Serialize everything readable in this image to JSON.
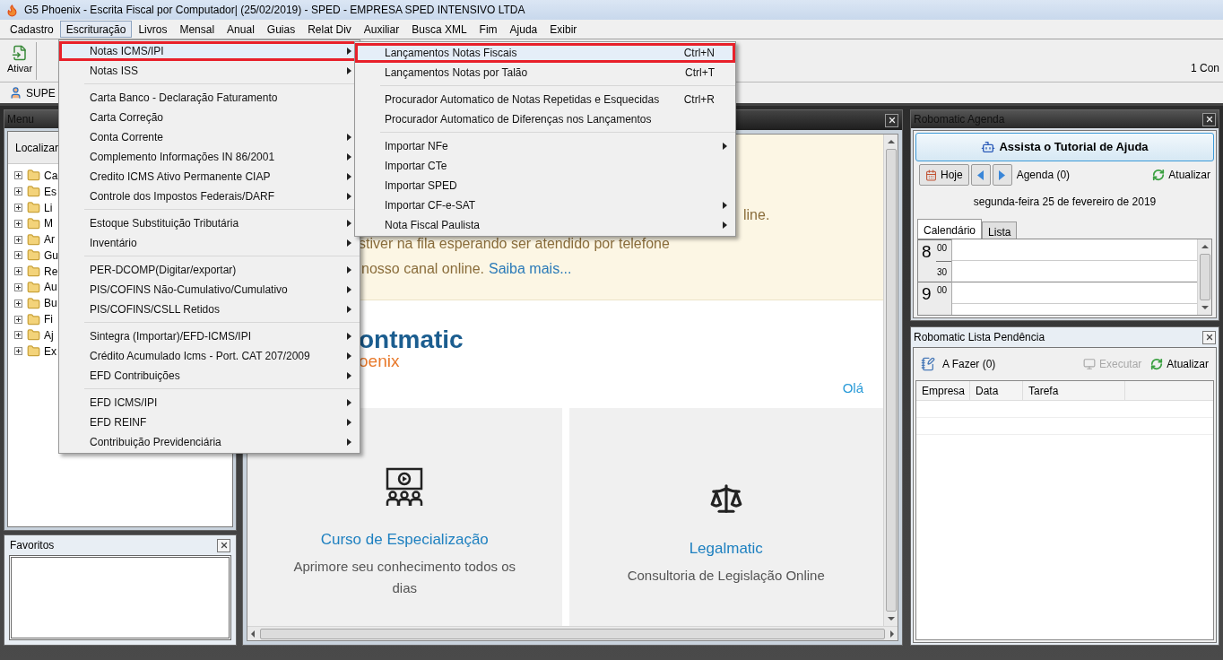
{
  "window": {
    "title": "G5 Phoenix - Escrita Fiscal por Computador| (25/02/2019) - SPED - EMPRESA SPED INTENSIVO LTDA"
  },
  "menu_bar": [
    {
      "label": "Cadastro",
      "selected": false
    },
    {
      "label": "Escrituração",
      "selected": true
    },
    {
      "label": "Livros",
      "selected": false
    },
    {
      "label": "Mensal",
      "selected": false
    },
    {
      "label": "Anual",
      "selected": false
    },
    {
      "label": "Guias",
      "selected": false
    },
    {
      "label": "Relat Div",
      "selected": false
    },
    {
      "label": "Auxiliar",
      "selected": false
    },
    {
      "label": "Busca XML",
      "selected": false
    },
    {
      "label": "Fim",
      "selected": false
    },
    {
      "label": "Ajuda",
      "selected": false
    },
    {
      "label": "Exibir",
      "selected": false
    }
  ],
  "toolbar": {
    "button": "Ativar",
    "status": "1 Con"
  },
  "user": {
    "name": "SUPE"
  },
  "escrituracao_menu": {
    "groups": [
      [
        {
          "label": "Notas ICMS/IPI",
          "has_submenu": true,
          "selected": true
        },
        {
          "label": "Notas ISS",
          "has_submenu": true,
          "selected": false
        }
      ],
      [
        {
          "label": "Carta Banco - Declaração Faturamento",
          "has_submenu": false,
          "selected": false
        },
        {
          "label": "Carta Correção",
          "has_submenu": false,
          "selected": false
        },
        {
          "label": "Conta Corrente",
          "has_submenu": true,
          "selected": false
        },
        {
          "label": "Complemento Informações IN 86/2001",
          "has_submenu": true,
          "selected": false
        },
        {
          "label": "Credito ICMS Ativo Permanente CIAP",
          "has_submenu": true,
          "selected": false
        },
        {
          "label": "Controle dos Impostos Federais/DARF",
          "has_submenu": true,
          "selected": false
        }
      ],
      [
        {
          "label": "Estoque Substituição Tributária",
          "has_submenu": true,
          "selected": false
        },
        {
          "label": "Inventário",
          "has_submenu": true,
          "selected": false
        }
      ],
      [
        {
          "label": "PER-DCOMP(Digitar/exportar)",
          "has_submenu": true,
          "selected": false
        },
        {
          "label": "PIS/COFINS Não-Cumulativo/Cumulativo",
          "has_submenu": true,
          "selected": false
        },
        {
          "label": "PIS/COFINS/CSLL Retidos",
          "has_submenu": true,
          "selected": false
        }
      ],
      [
        {
          "label": "Sintegra (Importar)/EFD-ICMS/IPI",
          "has_submenu": true,
          "selected": false
        },
        {
          "label": "Crédito Acumulado Icms - Port. CAT 207/2009",
          "has_submenu": true,
          "selected": false
        },
        {
          "label": "EFD Contribuições",
          "has_submenu": true,
          "selected": false
        }
      ],
      [
        {
          "label": "EFD ICMS/IPI",
          "has_submenu": true,
          "selected": false
        },
        {
          "label": "EFD REINF",
          "has_submenu": true,
          "selected": false
        },
        {
          "label": "Contribuição Previdenciária",
          "has_submenu": true,
          "selected": false
        }
      ]
    ]
  },
  "submenu": {
    "groups": [
      [
        {
          "label": "Lançamentos Notas Fiscais",
          "shortcut": "Ctrl+N",
          "has_submenu": false,
          "selected": true
        },
        {
          "label": "Lançamentos Notas por Talão",
          "shortcut": "Ctrl+T",
          "has_submenu": false,
          "selected": false
        }
      ],
      [
        {
          "label": "Procurador Automatico de Notas Repetidas e Esquecidas",
          "shortcut": "Ctrl+R",
          "has_submenu": false,
          "selected": false
        },
        {
          "label": "Procurador Automatico de Diferenças nos Lançamentos",
          "has_submenu": false,
          "selected": false
        }
      ],
      [
        {
          "label": "Importar NFe",
          "has_submenu": true,
          "selected": false
        },
        {
          "label": "Importar CTe",
          "has_submenu": false,
          "selected": false
        },
        {
          "label": "Importar SPED",
          "has_submenu": false,
          "selected": false
        },
        {
          "label": "Importar CF-e-SAT",
          "has_submenu": true,
          "selected": false
        },
        {
          "label": "Nota Fiscal Paulista",
          "has_submenu": true,
          "selected": false
        }
      ]
    ]
  },
  "menu_panel": {
    "title": "Menu",
    "search_label": "Localizar",
    "tree": [
      {
        "label": "Ca",
        "expanded": false
      },
      {
        "label": "Es",
        "expanded": false
      },
      {
        "label": "Li",
        "expanded": false
      },
      {
        "label": "M",
        "expanded": false
      },
      {
        "label": "Ar",
        "expanded": false
      },
      {
        "label": "Gu",
        "expanded": false
      },
      {
        "label": "Re",
        "expanded": false
      },
      {
        "label": "Au",
        "expanded": false
      },
      {
        "label": "Bu",
        "expanded": false
      },
      {
        "label": "Fi",
        "expanded": false
      },
      {
        "label": "Aj",
        "expanded": false
      },
      {
        "label": "Ex",
        "expanded": false
      }
    ]
  },
  "favoritos": {
    "title": "Favoritos"
  },
  "browser": {
    "banner_lines": [
      "line.",
      "stiver na fila esperando ser atendido por telefone",
      "nosso canal online."
    ],
    "link": "Saiba mais...",
    "logo": [
      "ontmatic",
      "oenix"
    ],
    "greeting": "Olá",
    "cards": [
      {
        "kind": "course",
        "title": "Curso de Especialização",
        "subtitle": "Aprimore seu conhecimento todos os dias"
      },
      {
        "kind": "legal",
        "title": "Legalmatic",
        "subtitle": "Consultoria de Legislação Online"
      }
    ]
  },
  "agenda": {
    "title": "Robomatic Agenda",
    "help_button": "Assista o Tutorial de Ajuda",
    "today": "Hoje",
    "agenda_count": "Agenda (0)",
    "refresh": "Atualizar",
    "date": "segunda-feira 25 de fevereiro de 2019",
    "tabs": [
      {
        "label": "Calendário",
        "selected": true
      },
      {
        "label": "Lista",
        "selected": false
      }
    ],
    "hours": [
      {
        "hour": "8",
        "slots": [
          "00",
          "30"
        ]
      },
      {
        "hour": "9",
        "slots": [
          "00"
        ]
      }
    ]
  },
  "pendencias": {
    "title": "Robomatic Lista Pendência",
    "todo": "A Fazer (0)",
    "execute": {
      "label": "Executar",
      "disabled": true
    },
    "refresh": "Atualizar",
    "columns": [
      "Empresa",
      "Data",
      "Tarefa"
    ]
  }
}
